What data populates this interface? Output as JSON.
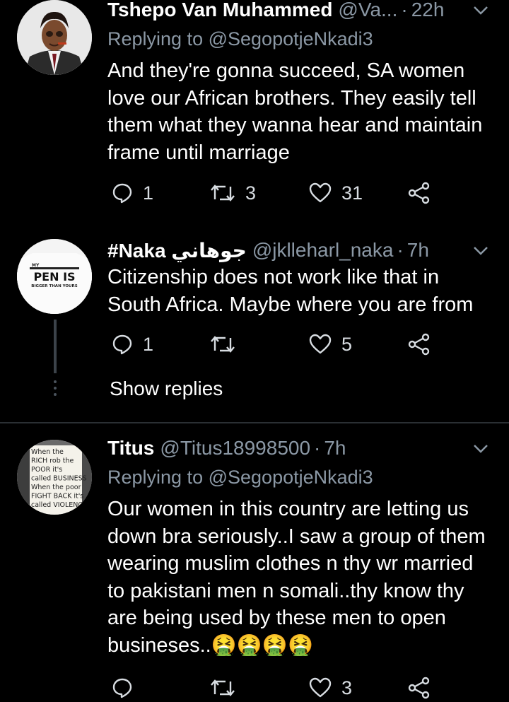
{
  "tweets": [
    {
      "name": "Tshepo Van Muhammed",
      "handle": "@Va...",
      "dot": "·",
      "time": "22h",
      "replying_prefix": "Replying to",
      "replying_to": "@SegopotjeNkadi3",
      "text": "And they're gonna succeed, SA women love our African brothers. They easily tell them what they wanna hear and maintain frame until marriage",
      "replies": "1",
      "retweets": "3",
      "likes": "31"
    },
    {
      "name": "#Naka جوهاني",
      "handle": "@jklleharl_naka",
      "dot": "·",
      "time": "7h",
      "text": "Citizenship does not work like that in South Africa. Maybe where you are from",
      "replies": "1",
      "retweets": "",
      "likes": "5",
      "avatar_text_top": "MY",
      "avatar_text_main": "PEN IS",
      "avatar_text_sub": "BIGGER THAN YOURS"
    },
    {
      "name": "Titus",
      "handle": "@Titus18998500",
      "dot": "·",
      "time": "7h",
      "replying_prefix": "Replying to",
      "replying_to": "@SegopotjeNkadi3",
      "text": "Our women in this country are letting us down bra seriously..I saw a group of them wearing muslim clothes n thy wr married to pakistani men n somali..thy know thy are being used by these men to open busineses..",
      "emoji": "🤮🤮🤮🤮",
      "replies": "",
      "retweets": "",
      "likes": "3",
      "avatar_sign": [
        "When the",
        "RICH rob the",
        "POOR it's",
        "called BUSINESS",
        "When the poor",
        "FIGHT BACK it's",
        "called VIOLENCE"
      ]
    }
  ],
  "show_replies": "Show replies",
  "icons": {
    "reply": "reply-icon",
    "retweet": "retweet-icon",
    "like": "heart-icon",
    "share": "share-icon",
    "more": "chevron-down-icon"
  },
  "colors": {
    "background": "#000000",
    "secondary_text": "#8b98a5",
    "divider": "#2a2f33"
  }
}
